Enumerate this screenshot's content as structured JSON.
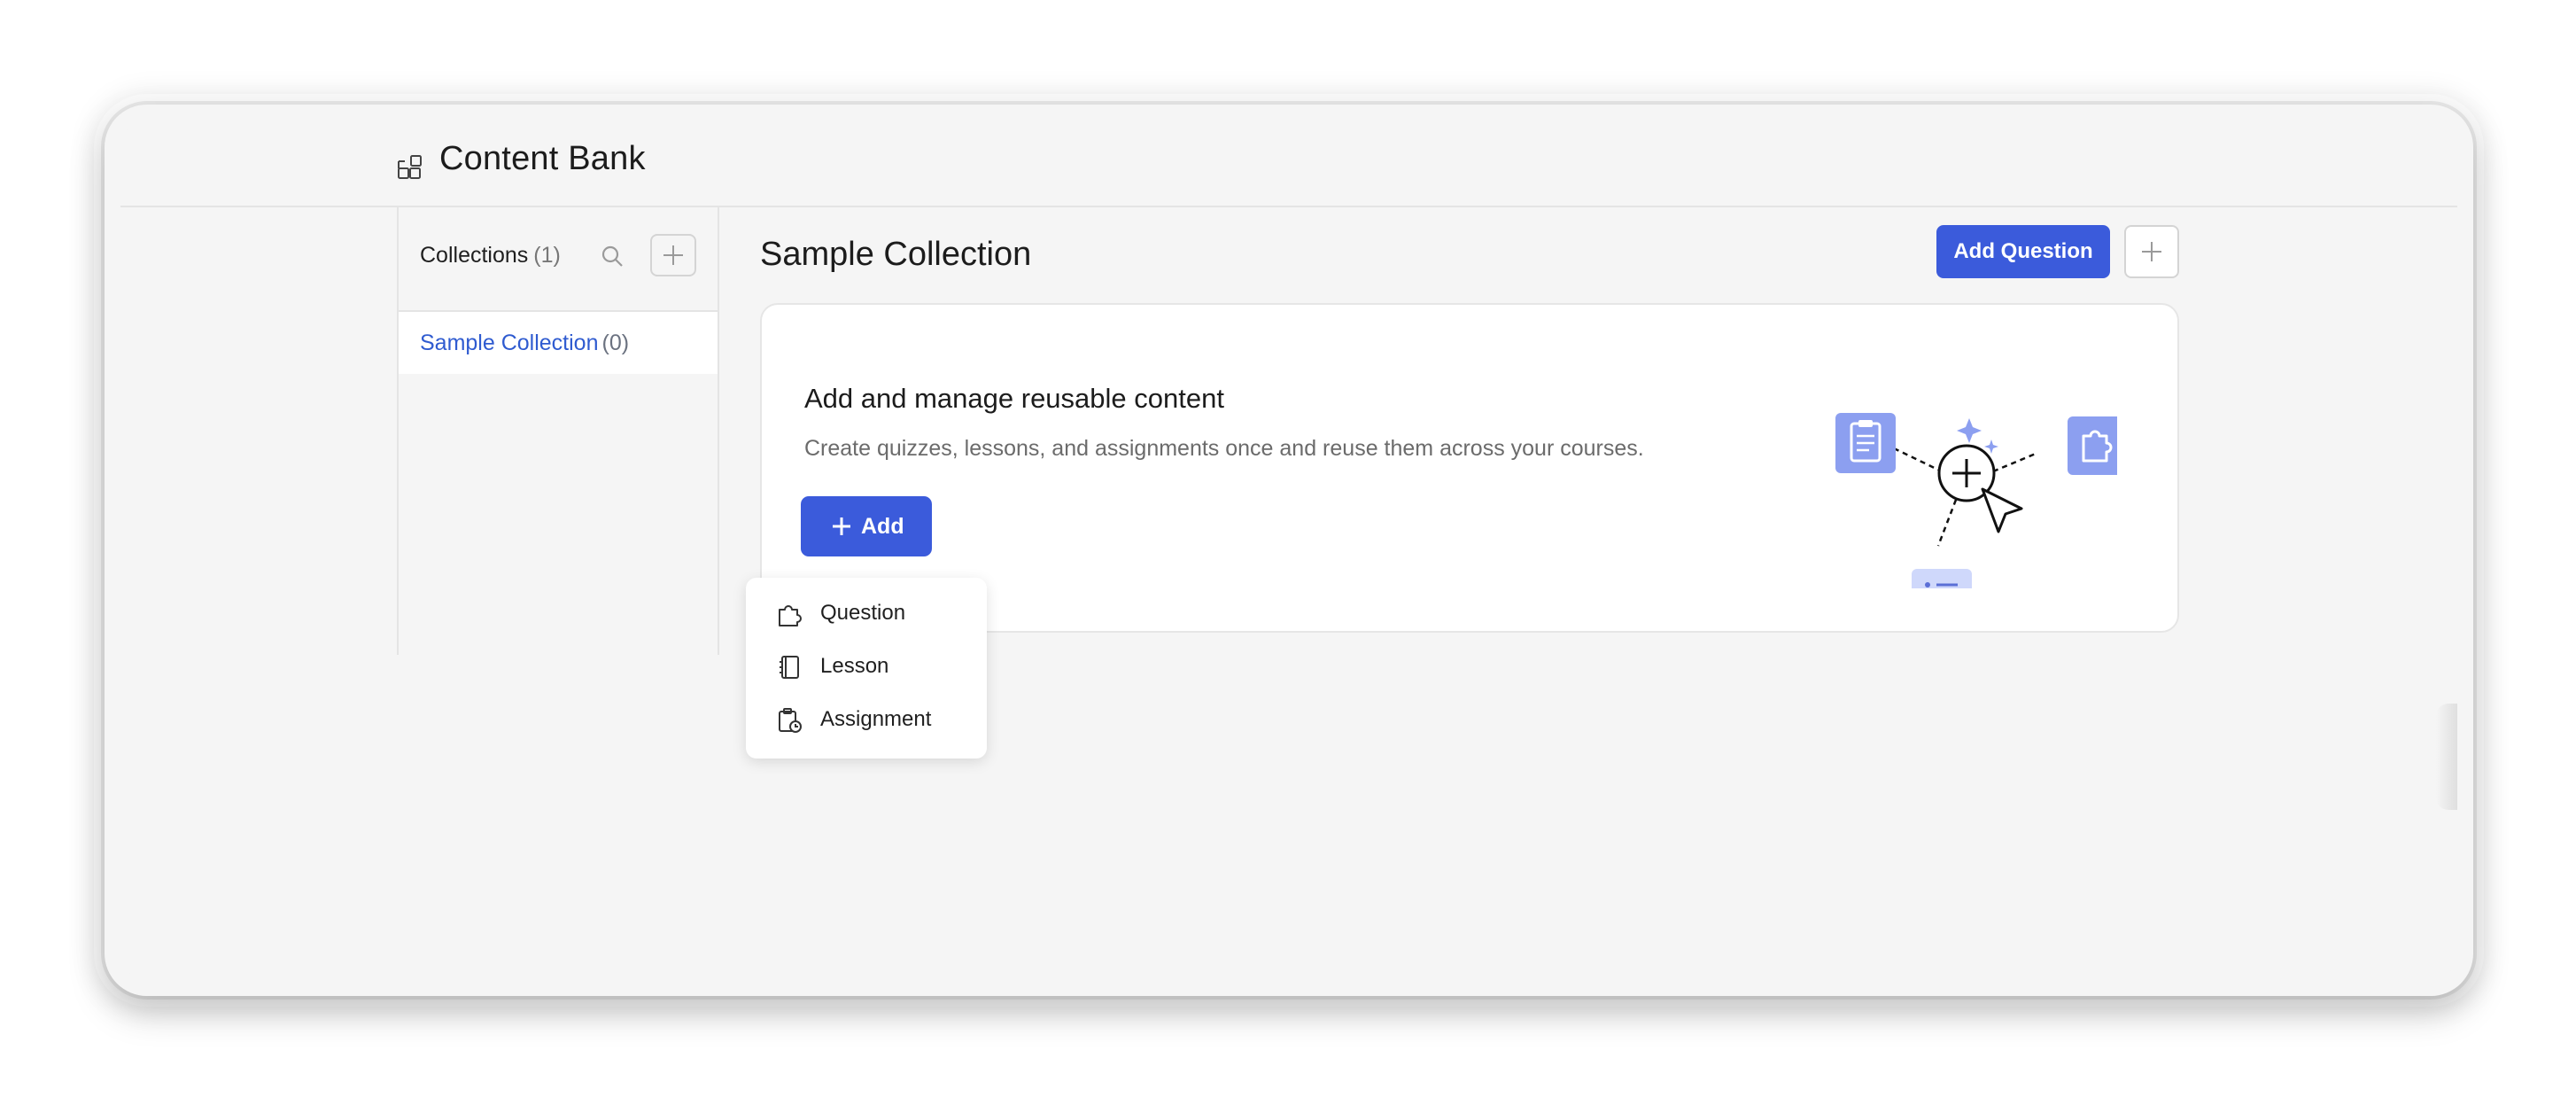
{
  "header": {
    "title": "Content Bank",
    "icon": "boxes-icon"
  },
  "sidebar": {
    "title": "Collections",
    "count": "(1)",
    "items": [
      {
        "label": "Sample Collection",
        "count": "(0)"
      }
    ]
  },
  "main": {
    "title": "Sample Collection",
    "add_question_label": "Add Question",
    "empty_state": {
      "heading": "Add and manage reusable content",
      "description": "Create quizzes, lessons, and assignments once and reuse them across your courses.",
      "add_label": "Add"
    }
  },
  "dropdown": {
    "items": [
      {
        "label": "Question",
        "icon": "puzzle-icon"
      },
      {
        "label": "Lesson",
        "icon": "notebook-icon"
      },
      {
        "label": "Assignment",
        "icon": "clipboard-clock-icon"
      }
    ]
  },
  "colors": {
    "primary": "#3b5bdb",
    "link": "#2f5bd0",
    "illustration": "#8c9ff0",
    "illustration_light": "#cfd8fb"
  }
}
